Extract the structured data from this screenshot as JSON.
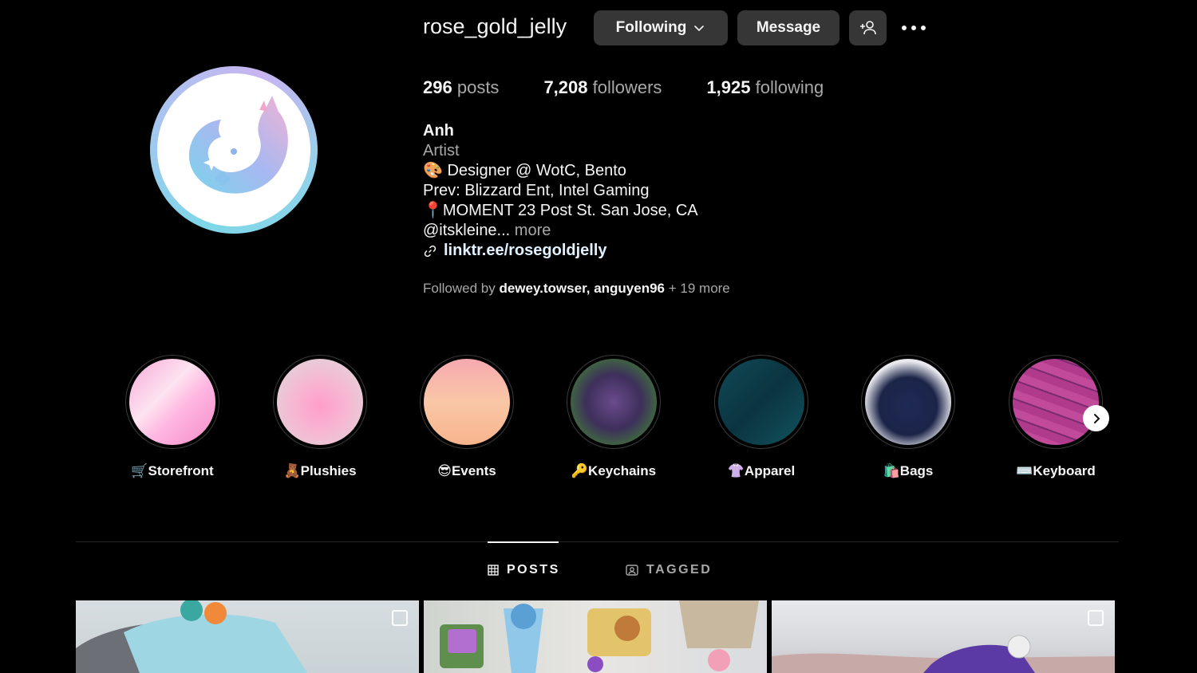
{
  "header": {
    "username": "rose_gold_jelly",
    "following_label": "Following",
    "message_label": "Message"
  },
  "stats": {
    "posts_count": "296",
    "posts_label": "posts",
    "followers_count": "7,208",
    "followers_label": "followers",
    "following_count": "1,925",
    "following_label": "following"
  },
  "bio": {
    "name": "Anh",
    "category": "Artist",
    "line1": "🎨 Designer @ WotC, Bento",
    "line2": "Prev: Blizzard Ent, Intel Gaming",
    "line3": "📍MOMENT 23 Post St. San Jose, CA",
    "line4": "@itskleine...",
    "more": "more",
    "link": "linktr.ee/rosegoldjelly"
  },
  "followed_by": {
    "prefix": "Followed by",
    "user1": "dewey.towser,",
    "user2": "anguyen96",
    "suffix": "+ 19 more"
  },
  "highlights": [
    {
      "label": "🛒Storefront"
    },
    {
      "label": "🧸Plushies"
    },
    {
      "label": "😎Events"
    },
    {
      "label": "🔑Keychains"
    },
    {
      "label": "👚Apparel"
    },
    {
      "label": "🛍️Bags"
    },
    {
      "label": "⌨️Keyboard"
    }
  ],
  "tabs": {
    "posts": "POSTS",
    "tagged": "TAGGED"
  }
}
